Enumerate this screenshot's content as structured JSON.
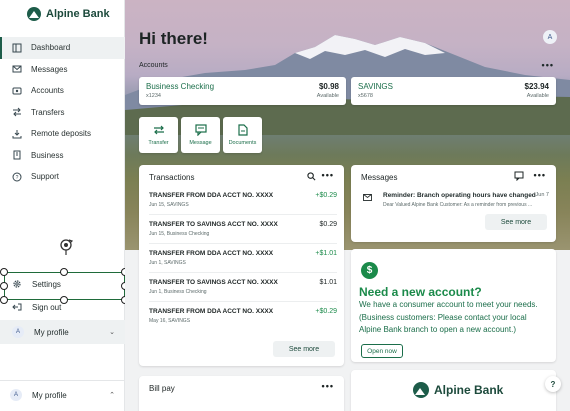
{
  "brand": {
    "name": "Alpine Bank",
    "color": "#1d5c49"
  },
  "sidebar": {
    "items": [
      {
        "label": "Dashboard",
        "icon": "dashboard-icon"
      },
      {
        "label": "Messages",
        "icon": "mail-icon"
      },
      {
        "label": "Accounts",
        "icon": "accounts-icon"
      },
      {
        "label": "Transfers",
        "icon": "transfer-icon"
      },
      {
        "label": "Remote deposits",
        "icon": "deposit-icon"
      },
      {
        "label": "Business",
        "icon": "business-icon"
      },
      {
        "label": "Support",
        "icon": "help-circle-icon"
      }
    ],
    "settings_label": "Settings",
    "signout_label": "Sign out",
    "profile_label": "My profile",
    "profile_avatar": "A",
    "bottom_profile_label": "My profile",
    "bottom_profile_avatar": "A"
  },
  "header": {
    "greeting": "Hi there!",
    "avatar": "A"
  },
  "accounts": {
    "label": "Accounts",
    "more": "•••",
    "list": [
      {
        "name": "Business Checking",
        "number": "x1234",
        "balance": "$0.98",
        "balance_label": "Available"
      },
      {
        "name": "SAVINGS",
        "number": "x5678",
        "balance": "$23.94",
        "balance_label": "Available"
      }
    ]
  },
  "quick_actions": [
    {
      "label": "Transfer",
      "icon": "transfer-icon"
    },
    {
      "label": "Message",
      "icon": "chat-icon"
    },
    {
      "label": "Documents",
      "icon": "document-icon"
    }
  ],
  "transactions": {
    "title": "Transactions",
    "more": "•••",
    "see_more": "See more",
    "rows": [
      {
        "desc": "TRANSFER FROM DDA ACCT NO. XXXX",
        "sub": "Jun 15, SAVINGS",
        "amount": "+$0.29",
        "positive": true
      },
      {
        "desc": "TRANSFER TO SAVINGS ACCT NO. XXXX",
        "sub": "Jun 15, Business Checking",
        "amount": "$0.29",
        "positive": false
      },
      {
        "desc": "TRANSFER FROM DDA ACCT NO. XXXX",
        "sub": "Jun 1, SAVINGS",
        "amount": "+$1.01",
        "positive": true
      },
      {
        "desc": "TRANSFER TO SAVINGS ACCT NO. XXXX",
        "sub": "Jun 1, Business Checking",
        "amount": "$1.01",
        "positive": false
      },
      {
        "desc": "TRANSFER FROM DDA ACCT NO. XXXX",
        "sub": "May 16, SAVINGS",
        "amount": "+$0.29",
        "positive": true
      }
    ]
  },
  "messages": {
    "title": "Messages",
    "more": "•••",
    "see_more": "See more",
    "item": {
      "subject": "Reminder: Branch operating hours have changed",
      "date": "Jun 7",
      "preview": "Dear Valued Alpine Bank Customer: As a reminder from previous ..."
    }
  },
  "promo": {
    "icon": "dollar-icon",
    "title": "Need a new account?",
    "body": "We have a consumer account to meet your needs. (Business customers: Please contact your local Alpine Bank branch to open a new account.)",
    "button": "Open now"
  },
  "billpay": {
    "title": "Bill pay",
    "more": "•••"
  },
  "footer_card": {
    "brand": "Alpine Bank"
  },
  "help": {
    "label": "?"
  }
}
